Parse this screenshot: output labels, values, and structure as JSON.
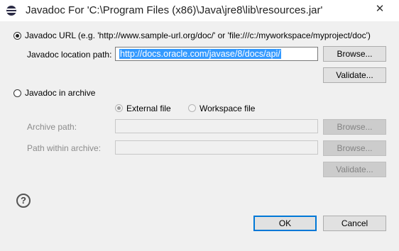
{
  "window": {
    "title": "Javadoc For 'C:\\Program Files (x86)\\Java\\jre8\\lib\\resources.jar'",
    "close_glyph": "✕"
  },
  "url_section": {
    "radio_label": "Javadoc URL (e.g. 'http://www.sample-url.org/doc/' or 'file:///c:/myworkspace/myproject/doc')",
    "selected": true,
    "location_label": "Javadoc location path:",
    "location_value": "http://docs.oracle.com/javase/8/docs/api/",
    "browse_label": "Browse...",
    "validate_label": "Validate..."
  },
  "archive_section": {
    "radio_label": "Javadoc in archive",
    "selected": false,
    "external_file_label": "External file",
    "workspace_file_label": "Workspace file",
    "archive_path_label": "Archive path:",
    "archive_path_value": "",
    "path_within_label": "Path within archive:",
    "path_within_value": "",
    "browse_archive_label": "Browse...",
    "browse_path_label": "Browse...",
    "validate_label": "Validate..."
  },
  "footer": {
    "help_glyph": "?",
    "ok_label": "OK",
    "cancel_label": "Cancel"
  },
  "icons": {
    "app": "eclipse-icon",
    "help": "help-icon",
    "close": "close-icon"
  }
}
